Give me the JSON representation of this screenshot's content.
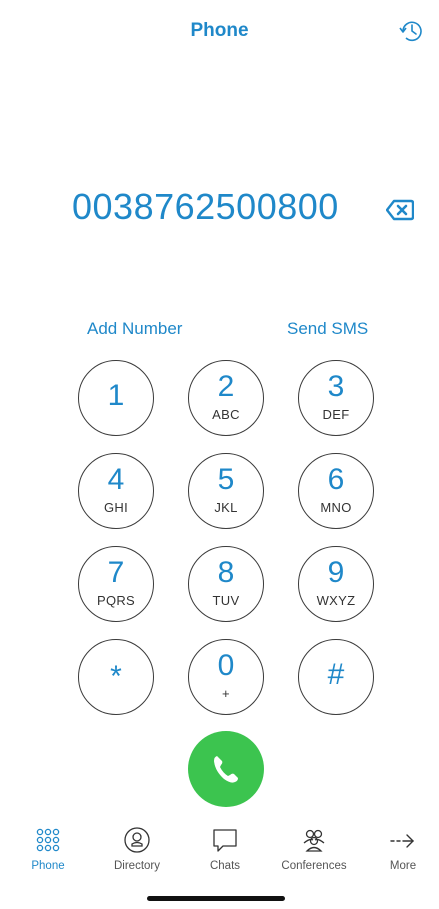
{
  "header": {
    "title": "Phone",
    "history_icon": "history-clock-icon"
  },
  "dialer": {
    "number": "0038762500800",
    "backspace_icon": "backspace-icon"
  },
  "actions": {
    "add_number": "Add Number",
    "send_sms": "Send SMS"
  },
  "keypad": [
    {
      "digit": "1",
      "letters": ""
    },
    {
      "digit": "2",
      "letters": "ABC"
    },
    {
      "digit": "3",
      "letters": "DEF"
    },
    {
      "digit": "4",
      "letters": "GHI"
    },
    {
      "digit": "5",
      "letters": "JKL"
    },
    {
      "digit": "6",
      "letters": "MNO"
    },
    {
      "digit": "7",
      "letters": "PQRS"
    },
    {
      "digit": "8",
      "letters": "TUV"
    },
    {
      "digit": "9",
      "letters": "WXYZ"
    },
    {
      "digit": "*",
      "letters": ""
    },
    {
      "digit": "0",
      "letters": "+"
    },
    {
      "digit": "#",
      "letters": ""
    }
  ],
  "call": {
    "icon": "phone-handset-icon",
    "color": "#3cc44f"
  },
  "tabs": [
    {
      "label": "Phone",
      "icon": "keypad-grid-icon",
      "active": true
    },
    {
      "label": "Directory",
      "icon": "contact-person-icon",
      "active": false
    },
    {
      "label": "Chats",
      "icon": "chat-bubble-icon",
      "active": false
    },
    {
      "label": "Conferences",
      "icon": "group-people-icon",
      "active": false
    },
    {
      "label": "More",
      "icon": "arrow-right-icon",
      "active": false
    }
  ],
  "colors": {
    "accent": "#1f88c9",
    "key_border": "#3a3a3a",
    "call_green": "#3cc44f"
  }
}
